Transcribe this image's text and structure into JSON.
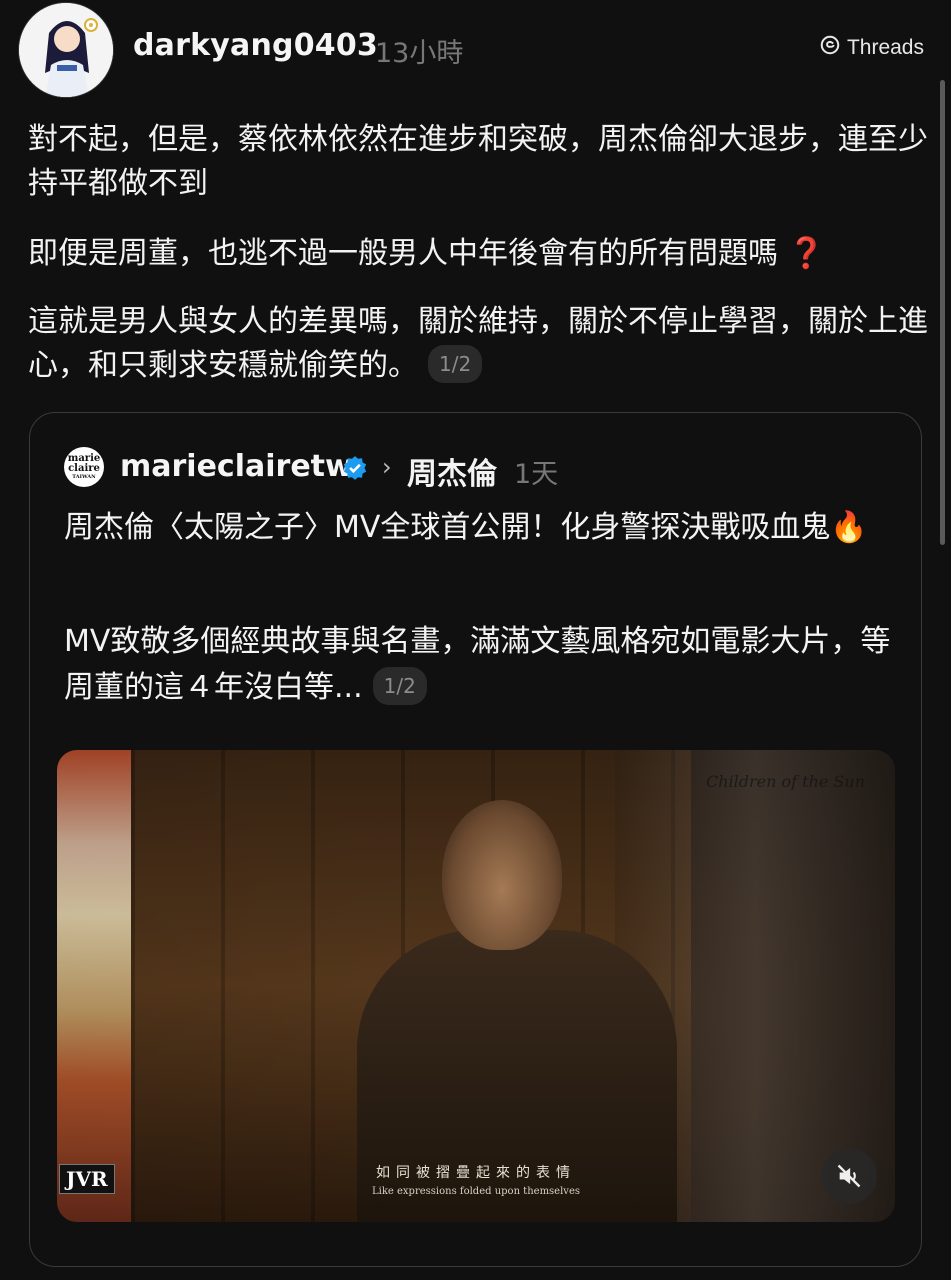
{
  "post": {
    "username": "darkyang0403",
    "time": "13小時",
    "badge_label": "Threads",
    "paragraphs": [
      "對不起，但是，蔡依林依然在進步和突破，周杰倫卻大退步，連至少持平都做不到",
      "即便是周董，也逃不過一般男人中年後會有的所有問題嗎",
      "這就是男人與女人的差異嗎，關於維持，關於不停止學習，關於上進心，和只剩求安穩就偷笑的。"
    ],
    "emoji": "❓",
    "page_indicator": "1/2"
  },
  "quoted": {
    "avatar_text_top": "marie",
    "avatar_text_bottom": "claire",
    "avatar_text_small": "TAIWAN",
    "username": "marieclairetw",
    "reply_to": "周杰倫",
    "time": "1天",
    "paragraphs": [
      "周杰倫〈太陽之子〉MV全球首公開！化身警探決戰吸血鬼",
      "MV致敬多個經典故事與名畫，滿滿文藝風格宛如電影大片，等周董的這４年沒白等..."
    ],
    "emoji": "🔥",
    "page_indicator": "1/2",
    "video": {
      "watermark": "Children of the Sun",
      "logo": "JVR",
      "subtitle_zh": "如同被摺疊起來的表情",
      "subtitle_en": "Like expressions folded upon themselves"
    }
  },
  "colors": {
    "background": "#101010",
    "text": "#f3f3f3",
    "muted": "#777777",
    "verified": "#1d9bf0"
  },
  "icons": [
    "threads-logo-icon",
    "verified-badge-icon",
    "chevron-right-icon",
    "muted-speaker-icon"
  ]
}
